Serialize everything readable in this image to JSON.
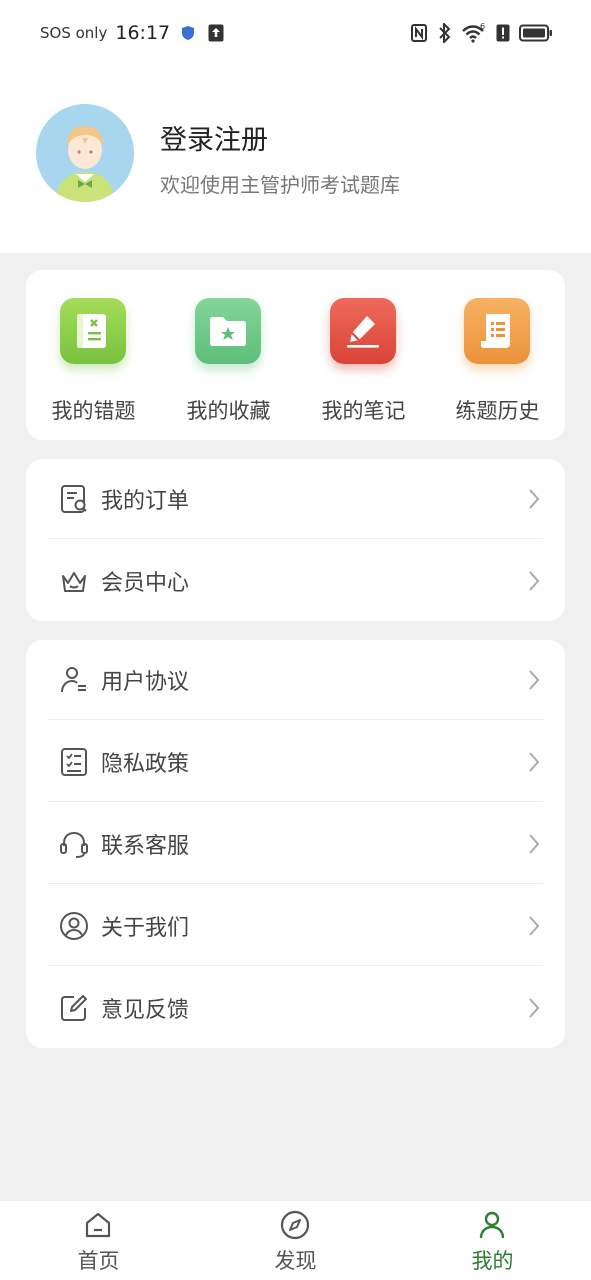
{
  "status_bar": {
    "sos": "SOS only",
    "time": "16:17",
    "icons": [
      "shield-icon",
      "upload-icon",
      "nfc-icon",
      "bluetooth-icon",
      "wifi-icon",
      "alert-icon",
      "battery-icon"
    ],
    "wifi_badge": "6"
  },
  "profile": {
    "title": "登录注册",
    "subtitle": "欢迎使用主管护师考试题库"
  },
  "quick_actions": [
    {
      "label": "我的错题",
      "icon": "notebook-x-icon",
      "color": "#8fd14f"
    },
    {
      "label": "我的收藏",
      "icon": "folder-star-icon",
      "color": "#6cc58a"
    },
    {
      "label": "我的笔记",
      "icon": "pencil-icon",
      "color": "#e85a4f"
    },
    {
      "label": "练题历史",
      "icon": "scroll-list-icon",
      "color": "#f0a04b"
    }
  ],
  "menu_group_1": [
    {
      "label": "我的订单",
      "icon": "order-icon"
    },
    {
      "label": "会员中心",
      "icon": "crown-icon"
    }
  ],
  "menu_group_2": [
    {
      "label": "用户协议",
      "icon": "user-agreement-icon"
    },
    {
      "label": "隐私政策",
      "icon": "checklist-icon"
    },
    {
      "label": "联系客服",
      "icon": "headset-icon"
    },
    {
      "label": "关于我们",
      "icon": "user-circle-icon"
    },
    {
      "label": "意见反馈",
      "icon": "edit-box-icon"
    }
  ],
  "tabs": [
    {
      "label": "首页",
      "icon": "home-icon"
    },
    {
      "label": "发现",
      "icon": "compass-icon"
    },
    {
      "label": "我的",
      "icon": "person-icon",
      "active": true
    }
  ],
  "colors": {
    "active_tab": "#2e7d32",
    "background": "#f0f0f0"
  }
}
